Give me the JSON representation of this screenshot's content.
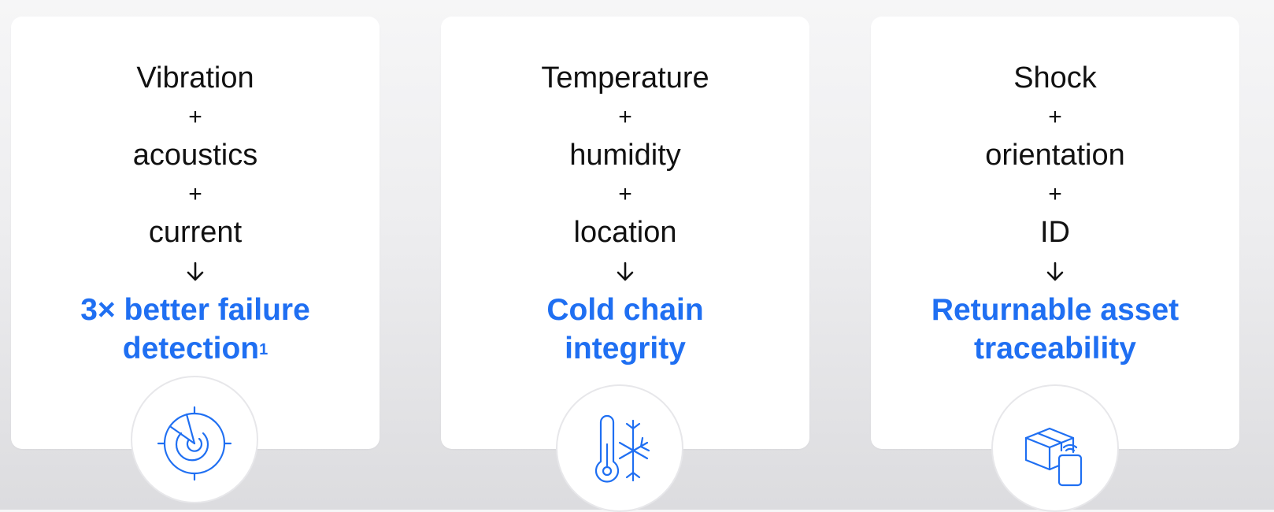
{
  "cards": [
    {
      "inputs": [
        "Vibration",
        "acoustics",
        "current"
      ],
      "operator": "+",
      "arrow": "↓",
      "result_line1": "3× better failure",
      "result_line2": "detection",
      "footnote": "1",
      "icon": "radar-icon"
    },
    {
      "inputs": [
        "Temperature",
        "humidity",
        "location"
      ],
      "operator": "+",
      "arrow": "↓",
      "result_line1": "Cold chain",
      "result_line2": "integrity",
      "icon": "thermometer-snowflake-icon"
    },
    {
      "inputs": [
        "Shock",
        "orientation",
        "ID"
      ],
      "operator": "+",
      "arrow": "↓",
      "result_line1": "Returnable asset",
      "result_line2": "traceability",
      "icon": "package-tag-icon"
    }
  ],
  "colors": {
    "accent": "#1f6ff2",
    "text": "#111111",
    "card": "#ffffff"
  }
}
